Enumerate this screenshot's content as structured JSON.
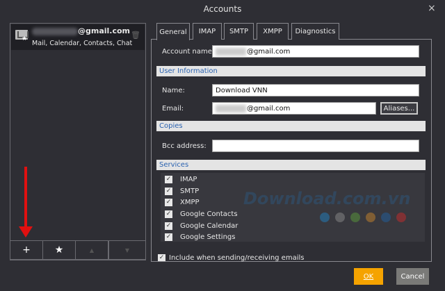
{
  "window": {
    "title": "Accounts",
    "close": "×"
  },
  "account": {
    "email_suffix": "@gmail.com",
    "services": "Mail, Calendar, Contacts, Chat"
  },
  "left_buttons": {
    "add": "+",
    "favorite": "★",
    "up": "▲",
    "down": "▼"
  },
  "tabs": [
    "General",
    "IMAP",
    "SMTP",
    "XMPP",
    "Diagnostics"
  ],
  "general": {
    "account_name_label": "Account name:",
    "account_name_value": "@gmail.com",
    "user_info_header": "User Information",
    "name_label": "Name:",
    "name_value": "Download VNN",
    "email_label": "Email:",
    "email_value": "@gmail.com",
    "aliases_button": "Aliases...",
    "copies_header": "Copies",
    "bcc_label": "Bcc address:",
    "bcc_value": "",
    "services_header": "Services",
    "services": [
      {
        "label": "IMAP",
        "checked": true
      },
      {
        "label": "SMTP",
        "checked": true
      },
      {
        "label": "XMPP",
        "checked": true
      },
      {
        "label": "Google Contacts",
        "checked": true
      },
      {
        "label": "Google Calendar",
        "checked": true
      },
      {
        "label": "Google Settings",
        "checked": true
      }
    ],
    "include_label": "Include when sending/receiving emails",
    "include_checked": true
  },
  "watermark": "Download.com.vn",
  "watermark_colors": [
    "#1f7fbf",
    "#8a8a8a",
    "#5a9a3a",
    "#c8842a",
    "#1f5f9f",
    "#c82a2a"
  ],
  "footer": {
    "ok": "OK",
    "cancel": "Cancel"
  },
  "colors": {
    "ok": "#f5a300",
    "section_text": "#2a62b0",
    "arrow": "#e01010"
  }
}
